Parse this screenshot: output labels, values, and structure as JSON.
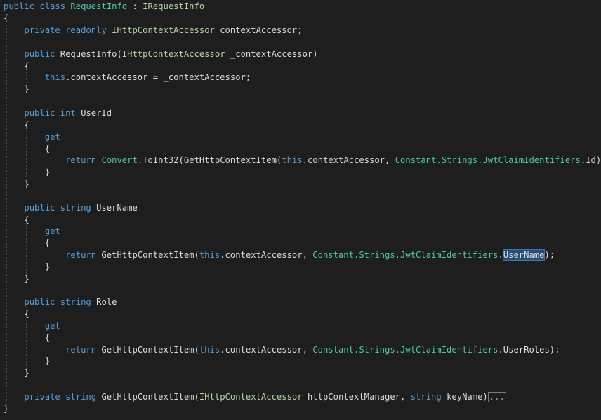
{
  "code": {
    "class_decl": {
      "kw1": "public",
      "kw2": "class",
      "name": "RequestInfo",
      "sep": " : ",
      "iface": "IRequestInfo"
    },
    "open_brace": "{",
    "close_brace": "}",
    "field": {
      "kw1": "private",
      "kw2": "readonly",
      "type": "IHttpContextAccessor",
      "name": " contextAccessor;"
    },
    "ctor_sig": {
      "kw": "public",
      "name": " RequestInfo(",
      "type": "IHttpContextAccessor",
      "param": " _contextAccessor)"
    },
    "ctor_body": {
      "kw": "this",
      "rest": ".contextAccessor = _contextAccessor;"
    },
    "prop_userid": {
      "kw1": "public",
      "kw2": "int",
      "name": " UserId"
    },
    "get_kw": "get",
    "ret_userid": {
      "kw": "return",
      "t1": "Convert",
      "p1": ".ToInt32(GetHttpContextItem(",
      "kw2": "this",
      "p2": ".contextAccessor, ",
      "t2": "Constant.Strings.JwtClaimIdentifiers",
      "p3": ".Id));"
    },
    "prop_username": {
      "kw1": "public",
      "kw2": "string",
      "name": " UserName"
    },
    "ret_username": {
      "kw": "return",
      "p1": " GetHttpContextItem(",
      "kw2": "this",
      "p2": ".contextAccessor, ",
      "t2": "Constant.Strings.JwtClaimIdentifiers",
      "dot": ".",
      "selected": "UserName",
      "p3": ");"
    },
    "prop_role": {
      "kw1": "public",
      "kw2": "string",
      "name": " Role"
    },
    "ret_role": {
      "kw": "return",
      "p1": " GetHttpContextItem(",
      "kw2": "this",
      "p2": ".contextAccessor, ",
      "t2": "Constant.Strings.JwtClaimIdentifiers",
      "p3": ".UserRoles);"
    },
    "method_sig": {
      "kw1": "private",
      "kw2": "string",
      "name": " GetHttpContextItem(",
      "type": "IHttpContextAccessor",
      "p1": " httpContextManager, ",
      "kw3": "string",
      "p2": " keyName)",
      "collapsed": "..."
    }
  }
}
